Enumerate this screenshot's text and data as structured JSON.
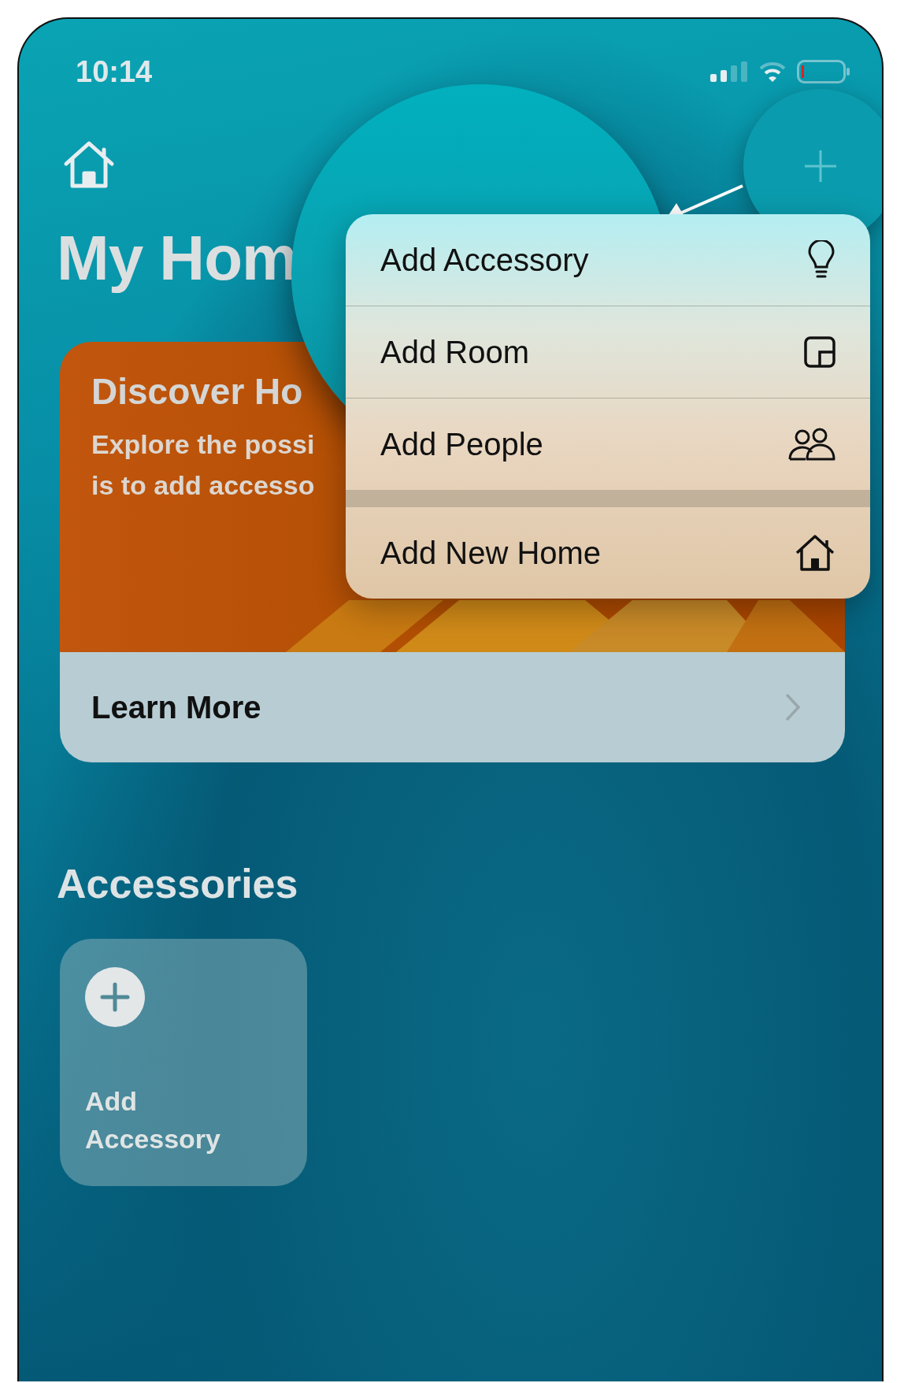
{
  "status_bar": {
    "time": "10:14"
  },
  "header": {
    "title": "My Hom"
  },
  "menu": {
    "groups": [
      [
        {
          "label": "Add Accessory",
          "kind": "bulb"
        },
        {
          "label": "Add Room",
          "kind": "room"
        },
        {
          "label": "Add People",
          "kind": "people"
        }
      ],
      [
        {
          "label": "Add New Home",
          "kind": "home"
        }
      ]
    ]
  },
  "discover_card": {
    "title": "Discover Ho",
    "lines": [
      "Explore the possi",
      "is to add accesso"
    ],
    "link": "Learn More"
  },
  "accessories": {
    "heading": "Accessories",
    "tiles": [
      {
        "label": "Add Accessory"
      }
    ]
  }
}
